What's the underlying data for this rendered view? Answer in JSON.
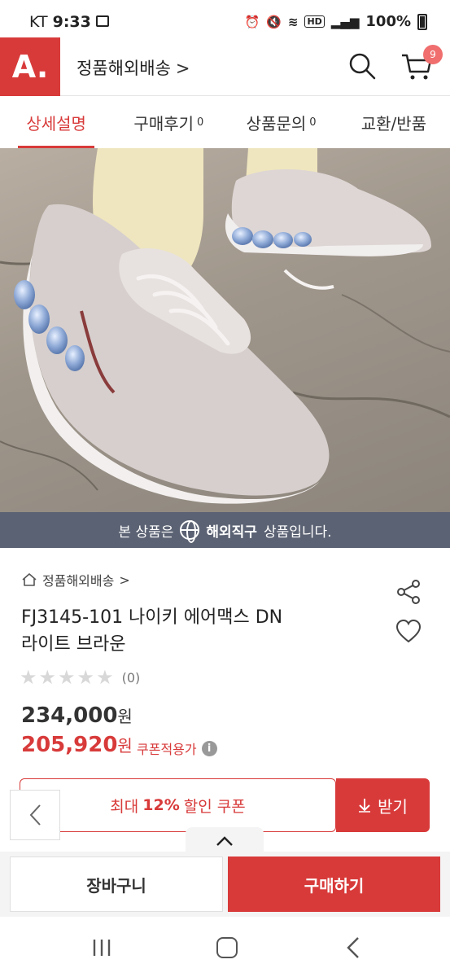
{
  "status_bar": {
    "carrier": "KT",
    "time": "9:33",
    "network": "HD",
    "battery": "100%"
  },
  "header": {
    "logo": "A.",
    "title": "정품해외배송",
    "chevron": ">",
    "cart_count": "9"
  },
  "tabs": [
    {
      "label": "상세설명",
      "count": ""
    },
    {
      "label": "구매후기",
      "count": "0"
    },
    {
      "label": "상품문의",
      "count": "0"
    },
    {
      "label": "교환/반품",
      "count": ""
    }
  ],
  "banner": {
    "prefix": "본 상품은",
    "highlight": "해외직구",
    "suffix": "상품입니다."
  },
  "product": {
    "breadcrumb": "정품해외배송",
    "breadcrumb_chevron": ">",
    "title_line1": "FJ3145-101 나이키 에어맥스 DN",
    "title_line2": "라이트 브라운",
    "rating_stars": 0,
    "rating_count": "(0)",
    "price": "234,000",
    "price_unit": "원",
    "sale_price": "205,920",
    "sale_unit": "원",
    "coupon_note": "쿠폰적용가",
    "info_glyph": "i"
  },
  "coupon": {
    "prefix": "최대",
    "percent": "12%",
    "suffix": "할인 쿠폰",
    "button": "받기"
  },
  "actions": {
    "cart": "장바구니",
    "buy": "구매하기"
  },
  "colors": {
    "brand": "#d83a3a",
    "banner": "#5b6273"
  }
}
